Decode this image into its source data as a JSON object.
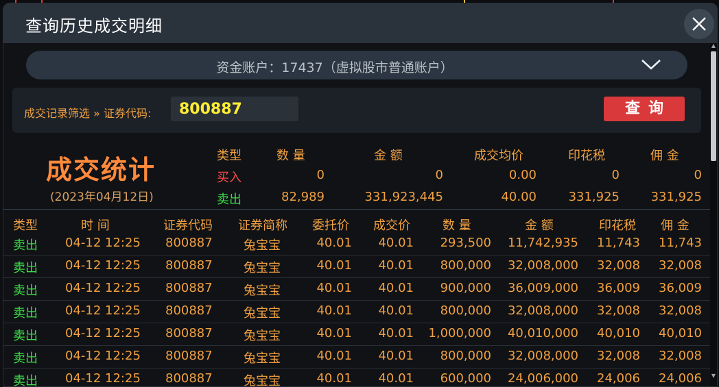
{
  "dialog": {
    "title": "查询历史成交明细"
  },
  "account": {
    "label": "资金账户：17437（虚拟股市普通账户）"
  },
  "filter": {
    "label": "成交记录筛选 » 证券代码:",
    "code_value": "800887",
    "query_label": "查询"
  },
  "stats": {
    "title": "成交统计",
    "date": "(2023年04月12日)",
    "headers": [
      "类型",
      "数 量",
      "金 额",
      "成交均价",
      "印花税",
      "佣 金"
    ],
    "buy": {
      "type": "买入",
      "qty": "0",
      "amount": "0",
      "avg": "0.00",
      "tax": "0",
      "fee": "0"
    },
    "sell": {
      "type": "卖出",
      "qty": "82,989",
      "amount": "331,923,445",
      "avg": "40.00",
      "tax": "331,925",
      "fee": "331,925"
    }
  },
  "table": {
    "headers": [
      "类型",
      "时 间",
      "证券代码",
      "证券简称",
      "委托价",
      "成交价",
      "数 量",
      "金 额",
      "印花税",
      "佣 金"
    ],
    "rows": [
      {
        "type": "卖出",
        "time": "04-12 12:25",
        "code": "800887",
        "name": "兔宝宝",
        "order_price": "40.01",
        "deal_price": "40.01",
        "qty": "293,500",
        "amount": "11,742,935",
        "tax": "11,743",
        "fee": "11,743"
      },
      {
        "type": "卖出",
        "time": "04-12 12:25",
        "code": "800887",
        "name": "兔宝宝",
        "order_price": "40.01",
        "deal_price": "40.01",
        "qty": "800,000",
        "amount": "32,008,000",
        "tax": "32,008",
        "fee": "32,008"
      },
      {
        "type": "卖出",
        "time": "04-12 12:25",
        "code": "800887",
        "name": "兔宝宝",
        "order_price": "40.01",
        "deal_price": "40.01",
        "qty": "900,000",
        "amount": "36,009,000",
        "tax": "36,009",
        "fee": "36,009"
      },
      {
        "type": "卖出",
        "time": "04-12 12:25",
        "code": "800887",
        "name": "兔宝宝",
        "order_price": "40.01",
        "deal_price": "40.01",
        "qty": "800,000",
        "amount": "32,008,000",
        "tax": "32,008",
        "fee": "32,008"
      },
      {
        "type": "卖出",
        "time": "04-12 12:25",
        "code": "800887",
        "name": "兔宝宝",
        "order_price": "40.01",
        "deal_price": "40.01",
        "qty": "1,000,000",
        "amount": "40,010,000",
        "tax": "40,010",
        "fee": "40,010"
      },
      {
        "type": "卖出",
        "time": "04-12 12:25",
        "code": "800887",
        "name": "兔宝宝",
        "order_price": "40.01",
        "deal_price": "40.01",
        "qty": "800,000",
        "amount": "32,008,000",
        "tax": "32,008",
        "fee": "32,008"
      },
      {
        "type": "卖出",
        "time": "04-12 12:25",
        "code": "800887",
        "name": "兔宝宝",
        "order_price": "40.01",
        "deal_price": "40.01",
        "qty": "600,000",
        "amount": "24,006,000",
        "tax": "24,006",
        "fee": "24,006"
      }
    ]
  },
  "icons": {
    "close": "close-icon",
    "dropdown": "chevron-down-icon"
  },
  "colors": {
    "accent": "#f0a040",
    "buy": "#ff4a4a",
    "sell": "#3fdc4a",
    "query_button": "#d9393b",
    "code_text": "#ffee33"
  }
}
